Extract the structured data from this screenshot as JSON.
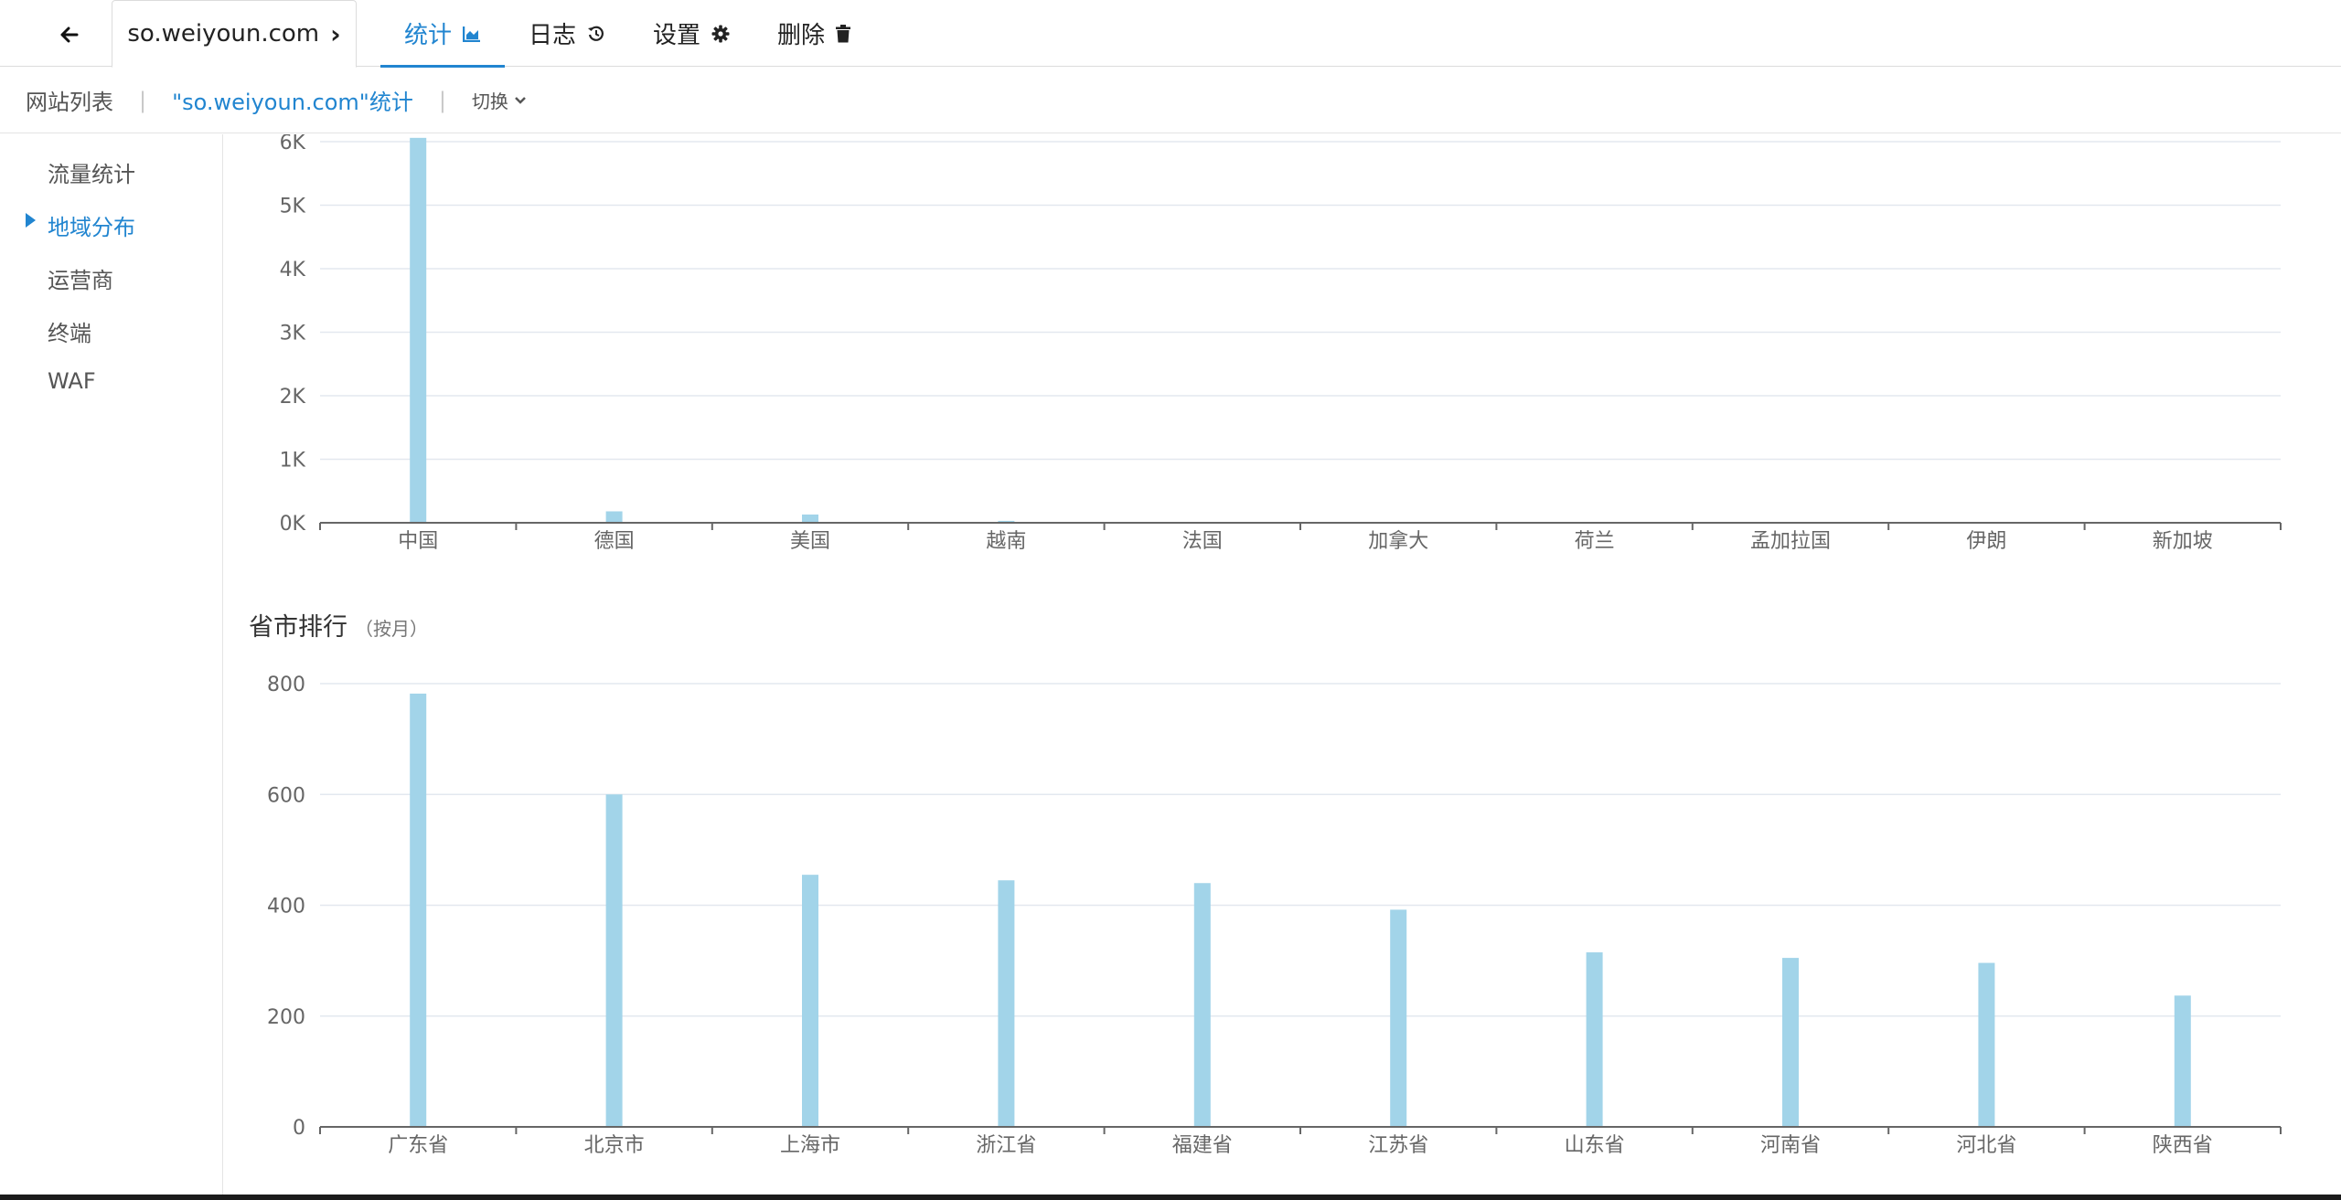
{
  "topbar": {
    "site_name": "so.weiyoun.com",
    "tabs": [
      {
        "label": "统计",
        "icon": "area-chart-icon",
        "active": true
      },
      {
        "label": "日志",
        "icon": "history-icon",
        "active": false
      },
      {
        "label": "设置",
        "icon": "gear-icon",
        "active": false
      },
      {
        "label": "删除",
        "icon": "trash-icon",
        "active": false
      }
    ]
  },
  "breadcrumb": {
    "home": "网站列表",
    "current": "\"so.weiyoun.com\"统计",
    "switch_label": "切换"
  },
  "sidebar": {
    "items": [
      {
        "label": "流量统计",
        "active": false
      },
      {
        "label": "地域分布",
        "active": true
      },
      {
        "label": "运营商",
        "active": false
      },
      {
        "label": "终端",
        "active": false
      },
      {
        "label": "WAF",
        "active": false
      }
    ]
  },
  "province_section": {
    "title": "省市排行",
    "subtitle": "（按月）"
  },
  "colors": {
    "accent": "#2185d0",
    "bar": "#a2d4e9",
    "grid": "#e3e8ef",
    "axis": "#666666"
  },
  "chart_data": [
    {
      "type": "bar",
      "categories": [
        "中国",
        "德国",
        "美国",
        "越南",
        "法国",
        "加拿大",
        "荷兰",
        "孟加拉国",
        "伊朗",
        "新加坡"
      ],
      "values": [
        6060,
        180,
        130,
        30,
        8,
        6,
        5,
        4,
        3,
        2
      ],
      "ylim": [
        0,
        6000
      ],
      "yticks": [
        0,
        1000,
        2000,
        3000,
        4000,
        5000,
        6000
      ],
      "ytick_labels": [
        "0K",
        "1K",
        "2K",
        "3K",
        "4K",
        "5K",
        "6K"
      ],
      "grid": true
    },
    {
      "type": "bar",
      "title": "省市排行",
      "categories": [
        "广东省",
        "北京市",
        "上海市",
        "浙江省",
        "福建省",
        "江苏省",
        "山东省",
        "河南省",
        "河北省",
        "陕西省"
      ],
      "values": [
        782,
        600,
        455,
        445,
        440,
        392,
        315,
        305,
        296,
        237
      ],
      "ylim": [
        0,
        800
      ],
      "yticks": [
        0,
        200,
        400,
        600,
        800
      ],
      "ytick_labels": [
        "0",
        "200",
        "400",
        "600",
        "800"
      ],
      "grid": true
    }
  ]
}
